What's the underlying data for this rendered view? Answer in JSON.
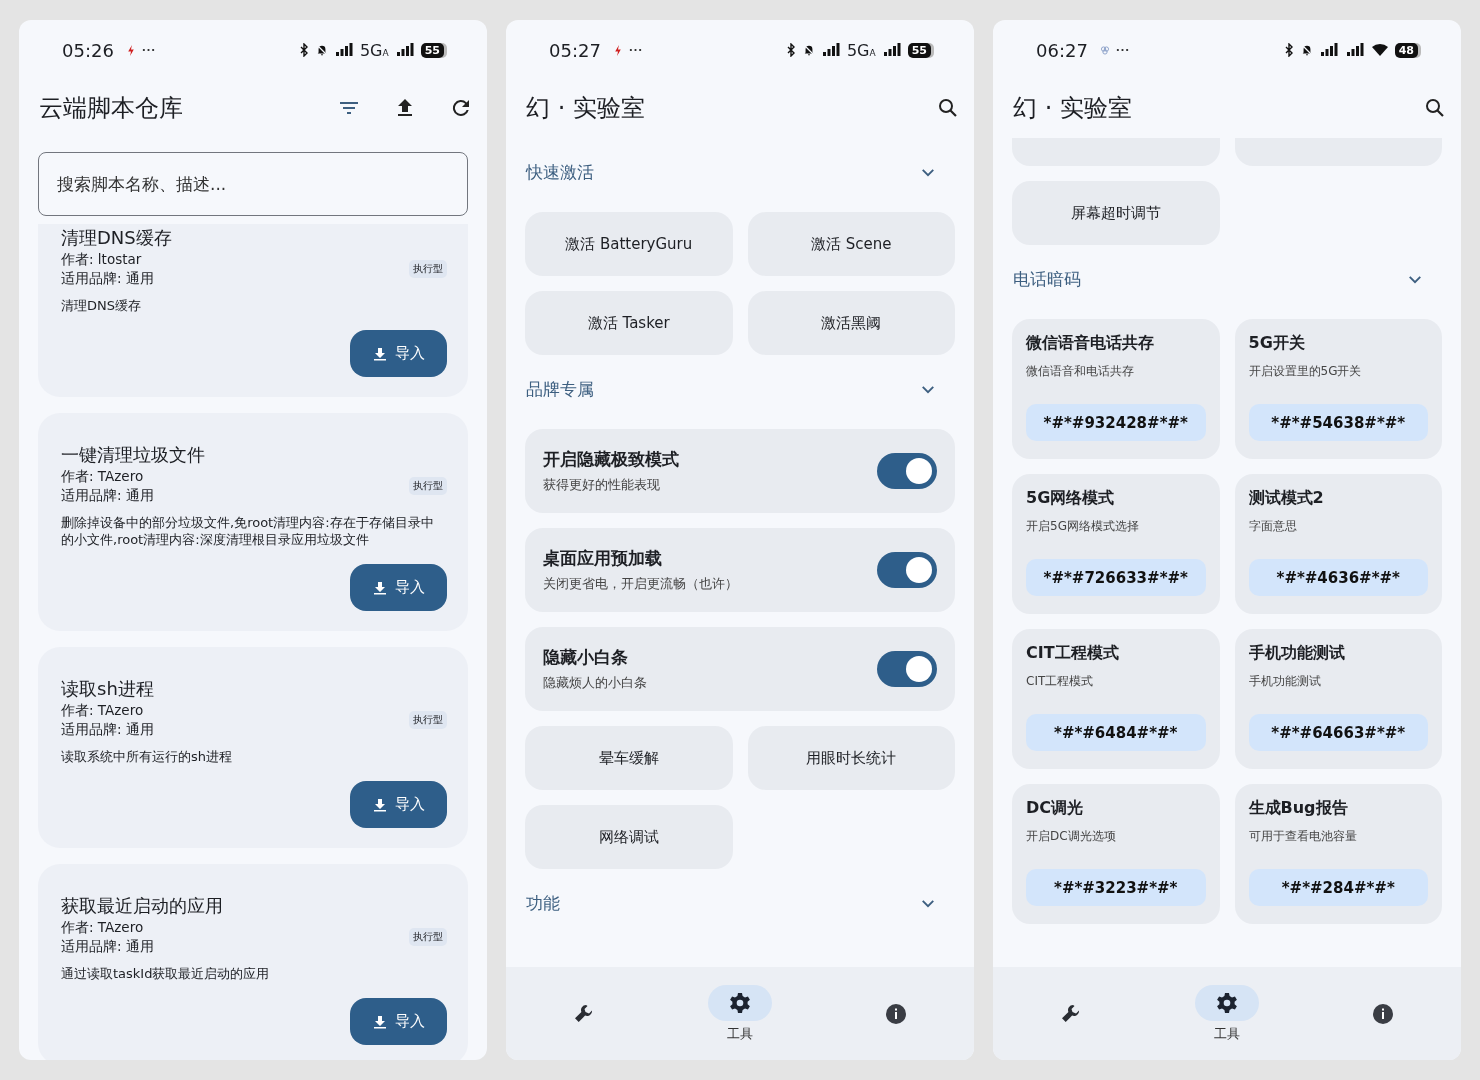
{
  "screens": [
    {
      "kind": "scripts",
      "status": {
        "kind": "cellular",
        "time": "05:26",
        "network": "5G",
        "network_sub": "A",
        "battery": "55"
      },
      "title": "云端脚本仓库",
      "search": {
        "placeholder": "搜索脚本名称、描述..."
      },
      "scripts": [
        {
          "title": "清理DNS缓存",
          "author": "作者: ltostar",
          "brand": "适用品牌: 通用",
          "tag": "执行型",
          "description": "清理DNS缓存",
          "button": "导入"
        },
        {
          "title": "一键清理垃圾文件",
          "author": "作者: TAzero",
          "brand": "适用品牌: 通用",
          "tag": "执行型",
          "description": "删除掉设备中的部分垃圾文件,免root清理内容:存在于存储目录中的小文件,root清理内容:深度清理根目录应用垃圾文件",
          "button": "导入"
        },
        {
          "title": "读取sh进程",
          "author": "作者: TAzero",
          "brand": "适用品牌: 通用",
          "tag": "执行型",
          "description": "读取系统中所有运行的sh进程",
          "button": "导入"
        },
        {
          "title": "获取最近启动的应用",
          "author": "作者: TAzero",
          "brand": "适用品牌: 通用",
          "tag": "执行型",
          "description": "通过读取taskId获取最近启动的应用",
          "button": "导入"
        }
      ]
    },
    {
      "kind": "lab",
      "status": {
        "kind": "cellular",
        "time": "05:27",
        "network": "5G",
        "network_sub": "A",
        "battery": "55"
      },
      "title": "幻 · 实验室",
      "sections": [
        {
          "title": "快速激活",
          "expanded": true,
          "items": [
            {
              "kind": "button",
              "label": "激活 BatteryGuru"
            },
            {
              "kind": "button",
              "label": "激活 Scene"
            },
            {
              "kind": "button",
              "label": "激活 Tasker"
            },
            {
              "kind": "button",
              "label": "激活黑阈"
            }
          ]
        },
        {
          "title": "品牌专属",
          "expanded": true,
          "items": [
            {
              "kind": "toggle",
              "label": "开启隐藏极致模式",
              "description": "获得更好的性能表现",
              "on": true
            },
            {
              "kind": "toggle",
              "label": "桌面应用预加载",
              "description": "关闭更省电，开启更流畅（也许）",
              "on": true
            },
            {
              "kind": "toggle",
              "label": "隐藏小白条",
              "description": "隐藏烦人的小白条",
              "on": true
            },
            {
              "kind": "button",
              "label": "晕车缓解"
            },
            {
              "kind": "button",
              "label": "用眼时长统计"
            },
            {
              "kind": "button",
              "label": "网络调试"
            }
          ]
        },
        {
          "title": "功能",
          "expanded": true
        }
      ],
      "nav": [
        {
          "selected": false
        },
        {
          "label": "工具",
          "selected": true
        },
        {
          "selected": false
        }
      ]
    },
    {
      "kind": "lab",
      "status": {
        "kind": "wifi",
        "time": "06:27",
        "battery": "48"
      },
      "title": "幻 · 实验室",
      "cut_top": true,
      "sections": [
        {
          "items": [
            {
              "kind": "button",
              "label": "屏幕超时调节"
            }
          ]
        },
        {
          "title": "电话暗码",
          "expanded": true,
          "items": [
            {
              "kind": "code",
              "label": "微信语音电话共存",
              "description": "微信语音和电话共存",
              "code": "*#*#932428#*#*"
            },
            {
              "kind": "code",
              "label": "5G开关",
              "description": "开启设置里的5G开关",
              "code": "*#*#54638#*#*"
            },
            {
              "kind": "code",
              "label": "5G网络模式",
              "description": "开启5G网络模式选择",
              "code": "*#*#726633#*#*"
            },
            {
              "kind": "code",
              "label": "测试模式2",
              "description": "字面意思",
              "code": "*#*#4636#*#*"
            },
            {
              "kind": "code",
              "label": "CIT工程模式",
              "description": "CIT工程模式",
              "code": "*#*#6484#*#*"
            },
            {
              "kind": "code",
              "label": "手机功能测试",
              "description": "手机功能测试",
              "code": "*#*#64663#*#*"
            },
            {
              "kind": "code",
              "label": "DC调光",
              "description": "开启DC调光选项",
              "code": "*#*#3223#*#*"
            },
            {
              "kind": "code",
              "label": "生成Bug报告",
              "description": "可用于查看电池容量",
              "code": "*#*#284#*#*"
            }
          ]
        }
      ],
      "nav": [
        {
          "selected": false
        },
        {
          "label": "工具",
          "selected": true
        },
        {
          "selected": false
        }
      ]
    }
  ]
}
